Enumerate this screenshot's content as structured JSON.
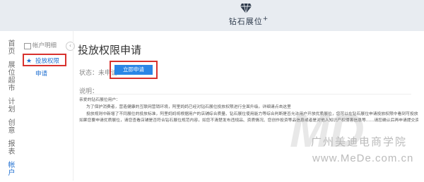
{
  "header": {
    "brand": "钻石展位",
    "brand_plus": "+"
  },
  "left_nav": [
    {
      "label": "首页"
    },
    {
      "label": "展位超市"
    },
    {
      "label": "计划"
    },
    {
      "label": "创意"
    },
    {
      "label": "报表"
    },
    {
      "label": "帐户"
    }
  ],
  "sub_nav": {
    "section_title": "帐户明细",
    "collapse_glyph": "‹",
    "active_item": "投放权限申请"
  },
  "main": {
    "title": "投放权限申请",
    "status_label": "状态：未申请",
    "apply_button": "立即申请",
    "explain_label": "说明：",
    "notice": [
      "亲爱的钻石展位用户：",
      "为了保护消费者，营造健康的互联网营销环境，阿里妈妈已经对钻石展位投放权限进行全面升级。详细请点击这里",
      "投放规则中新增了不同展位的投放标准，阿里妈妈将根据用户的店铺综合质量、钻石展位使用能力等综合判断是否允许用户开放优质展位，您可以在钻石展位申请投放权限中看到可投放的展位。",
      "如果您要申请优质展位，请您查看店铺是否符合钻石展位规范内容，如您不清楚发布违规品、资质情况、您创作投资等品信息或者是对他人知识产权侵害信息等……请您确认后再申请提交资料后的投放权限。"
    ]
  },
  "watermark": {
    "logo": "MD",
    "company": "广州美迪电商学院",
    "url": "www.MeDe.com.cn"
  },
  "colors": {
    "accent": "#2b86e6",
    "highlight_border": "#d8322e",
    "topbar_bg": "#e8ecf1"
  }
}
